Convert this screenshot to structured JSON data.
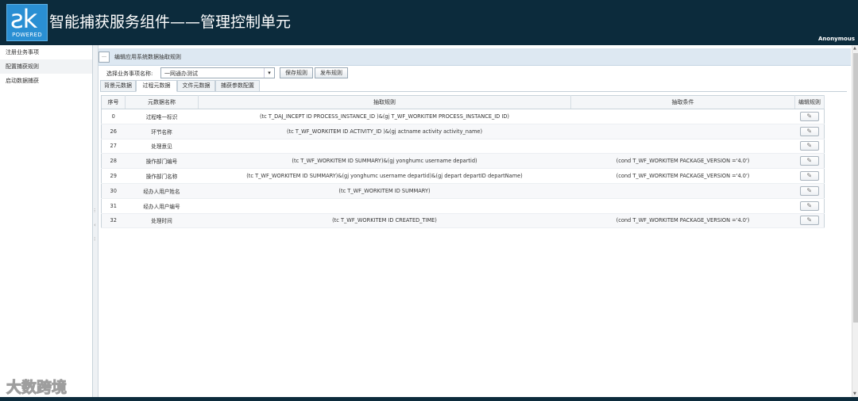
{
  "header": {
    "logo_mark": "ƨk",
    "logo_sub": "POWERED",
    "title": "智能捕获服务组件——管理控制单元",
    "user": "Anonymous"
  },
  "sidebar": {
    "items": [
      {
        "label": "注册业务事项"
      },
      {
        "label": "配置捕获规则"
      },
      {
        "label": "启动数据捕获"
      }
    ]
  },
  "panel": {
    "title": "编辑应用系统数据抽取规则",
    "select_label": "选择业务事项名称:",
    "select_value": "一网通办测试",
    "save_label": "保存规则",
    "publish_label": "发布规则"
  },
  "tabs": [
    {
      "label": "背景元数据"
    },
    {
      "label": "过程元数据"
    },
    {
      "label": "文件元数据"
    },
    {
      "label": "捕获参数配置"
    }
  ],
  "table": {
    "headers": [
      "序号",
      "元数据名称",
      "抽取规则",
      "抽取条件",
      "编辑规则"
    ],
    "rows": [
      {
        "no": "0",
        "name": "过程唯一标识",
        "rule": "(tc T_DAJ_INCEPT ID PROCESS_INSTANCE_ID )&(gj T_WF_WORKITEM PROCESS_INSTANCE_ID ID)",
        "cond": ""
      },
      {
        "no": "26",
        "name": "环节名称",
        "rule": "(tc T_WF_WORKITEM ID ACTIVITY_ID )&(gj actname activity activity_name)",
        "cond": ""
      },
      {
        "no": "27",
        "name": "处理意见",
        "rule": "",
        "cond": ""
      },
      {
        "no": "28",
        "name": "操作部门编号",
        "rule": "(tc T_WF_WORKITEM ID SUMMARY)&(gj yonghumc username departid)",
        "cond": "(cond T_WF_WORKITEM PACKAGE_VERSION ='4.0')"
      },
      {
        "no": "29",
        "name": "操作部门名称",
        "rule": "(tc T_WF_WORKITEM ID SUMMARY)&(gj yonghumc username departid)&(gj depart departID departName)",
        "cond": "(cond T_WF_WORKITEM PACKAGE_VERSION ='4.0')"
      },
      {
        "no": "30",
        "name": "经办人用户姓名",
        "rule": "(tc T_WF_WORKITEM ID SUMMARY)",
        "cond": ""
      },
      {
        "no": "31",
        "name": "经办人用户编号",
        "rule": "",
        "cond": ""
      },
      {
        "no": "32",
        "name": "处理时间",
        "rule": "(tc T_WF_WORKITEM ID CREATED_TIME)",
        "cond": "(cond T_WF_WORKITEM PACKAGE_VERSION ='4.0')"
      }
    ]
  },
  "watermark": "大数跨境",
  "colors": {
    "header_bg": "#0c2b3c",
    "logo_bg": "#2a8fd3",
    "panel_head_bg": "#dde8f2"
  },
  "icons": {
    "edit": "pencil-icon",
    "dropdown": "chevron-down-icon"
  }
}
